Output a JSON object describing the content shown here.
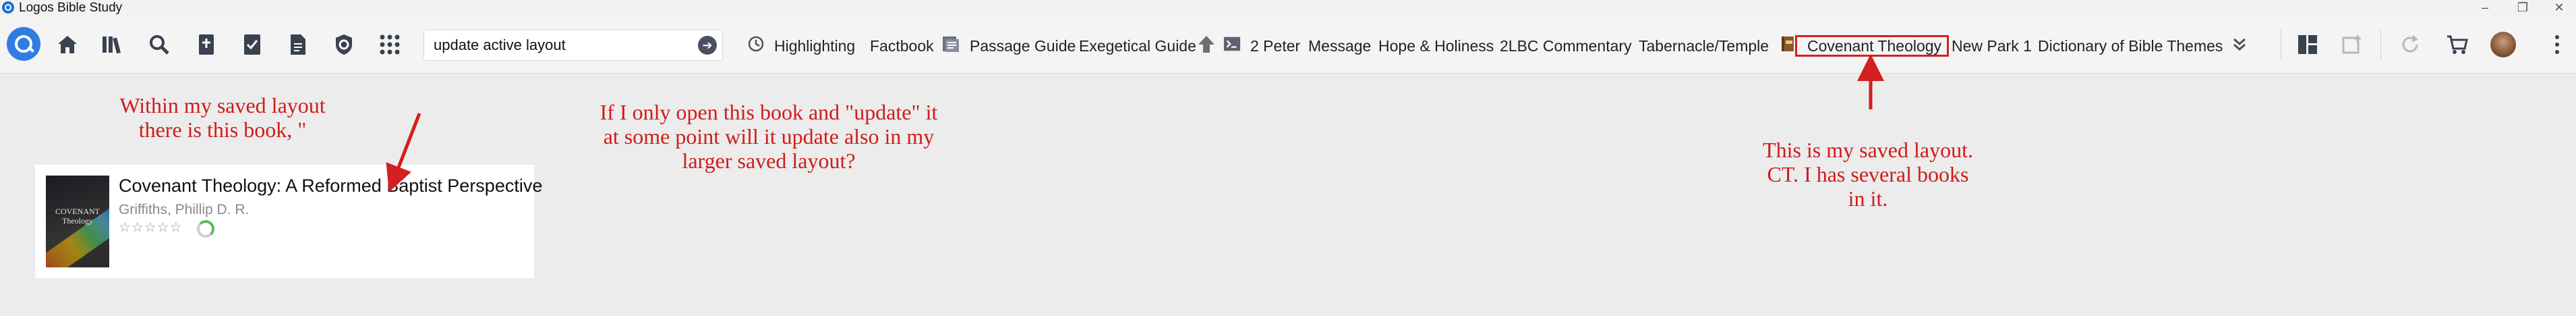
{
  "window": {
    "title": "Logos Bible Study",
    "controls": [
      "–",
      "❐",
      "✕"
    ]
  },
  "toolbar": {
    "icons": [
      "home-icon",
      "library-icon",
      "search-icon",
      "guides-icon",
      "tasks-icon",
      "documents-icon",
      "shield-icon",
      "apps-grid-icon"
    ],
    "search": {
      "value": "update active layout"
    },
    "shortcuts": [
      "Highlighting",
      "Factbook",
      "Passage Guide",
      "Exegetical Guide",
      "2 Peter",
      "Message",
      "Hope & Holiness",
      "2LBC Commentary",
      "Tabernacle/Temple",
      "Covenant Theology",
      "New Park 1",
      "Dictionary of Bible Themes"
    ],
    "highlighted_shortcut": "Covenant Theology",
    "right_icons": [
      "layouts-icon",
      "add-panel-icon",
      "sync-icon",
      "cart-icon",
      "avatar"
    ]
  },
  "book": {
    "cover_text": "COVENANT Theology",
    "title": "Covenant Theology: A Reformed Baptist Perspective",
    "author": "Griffiths, Phillip D. R.",
    "rating_stars": "☆☆☆☆☆",
    "rating": 0
  },
  "annotations": {
    "left": "Within my saved layout there is this book, \"",
    "middle": "If I only open this book and \"update\" it at some point will it update also in my larger saved layout?",
    "right": "This is my saved layout. CT. I has several books in it."
  },
  "colors": {
    "accent": "#2f7de1",
    "annotation": "#cf1c1c"
  }
}
